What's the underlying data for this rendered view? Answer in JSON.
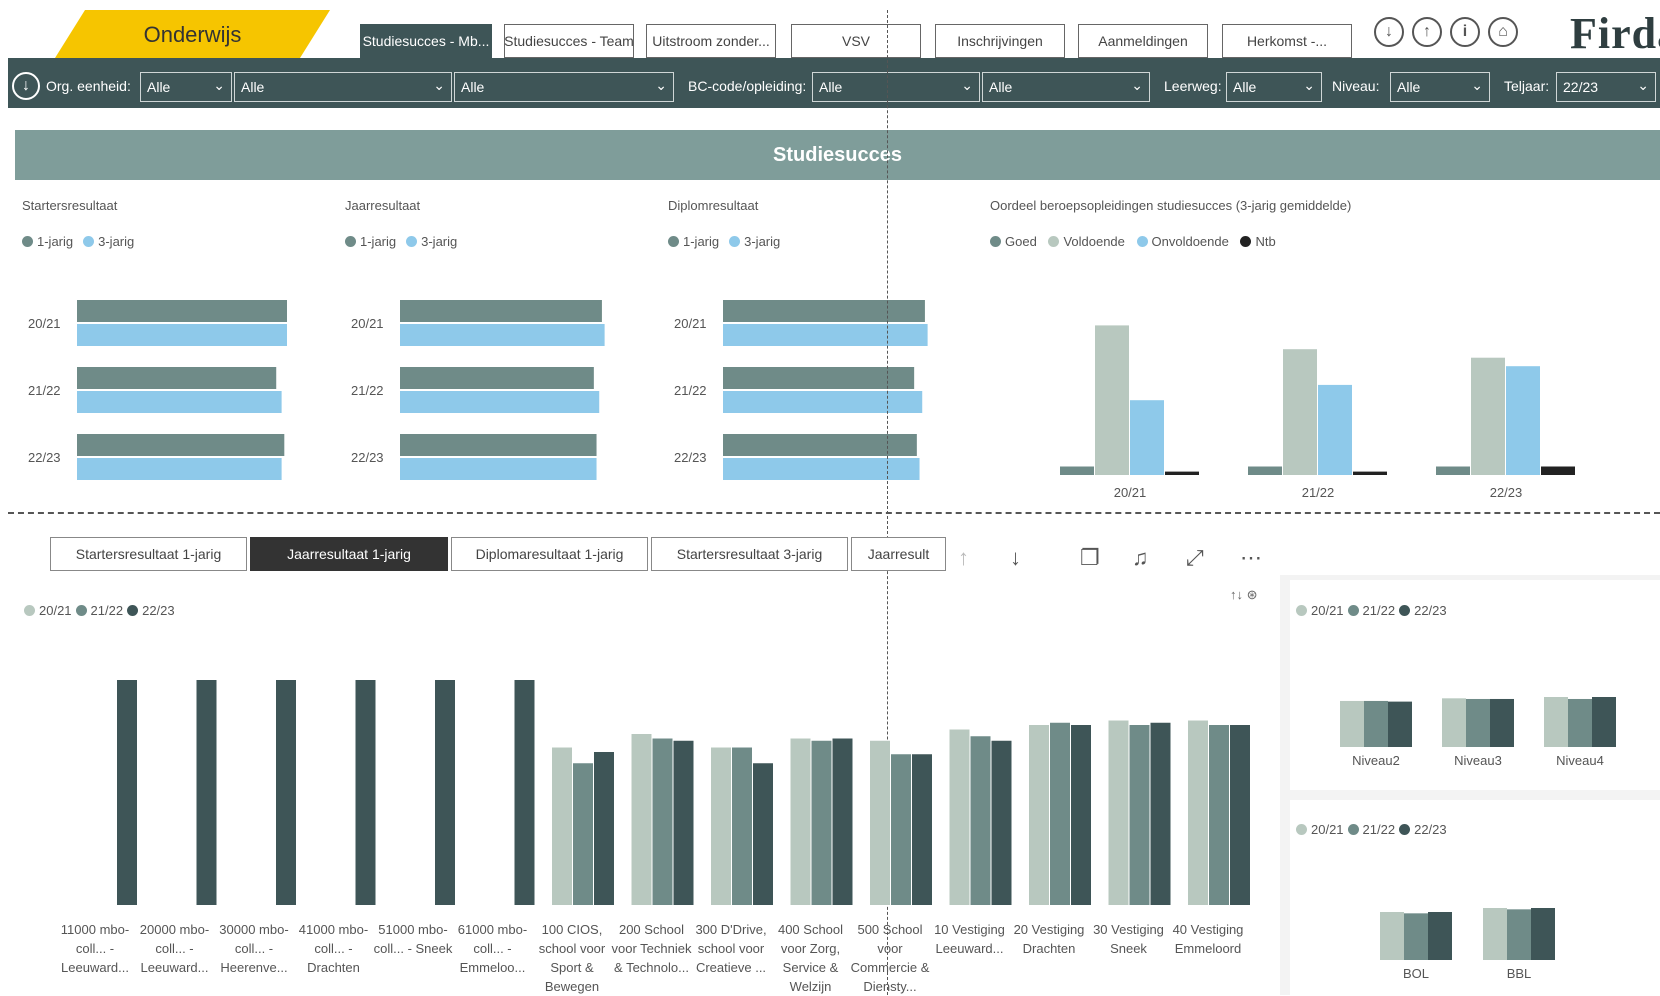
{
  "header": {
    "brand_tab": "Onderwijs",
    "tabs": [
      {
        "label": "Studiesucces - Mb...",
        "active": true
      },
      {
        "label": "Studiesucces - Team",
        "active": false
      },
      {
        "label": "Uitstroom zonder...",
        "active": false
      },
      {
        "label": "VSV",
        "active": false
      },
      {
        "label": "Inschrijvingen",
        "active": false
      },
      {
        "label": "Aanmeldingen",
        "active": false
      },
      {
        "label": "Herkomst -...",
        "active": false
      }
    ],
    "icons": [
      "download-circle-icon",
      "upload-circle-icon",
      "info-circle-icon",
      "home-circle-icon"
    ],
    "logo": "Firda"
  },
  "filters": {
    "org_label": "Org. eenheid:",
    "org_values": [
      "Alle",
      "Alle",
      "Alle"
    ],
    "bc_label": "BC-code/opleiding:",
    "bc_values": [
      "Alle",
      "Alle"
    ],
    "leerweg_label": "Leerweg:",
    "leerweg_value": "Alle",
    "niveau_label": "Niveau:",
    "niveau_value": "Alle",
    "teljaar_label": "Teljaar:",
    "teljaar_value": "22/23"
  },
  "banner": "Studiesucces",
  "colors": {
    "dark_teal": "#3e5557",
    "mid_teal": "#6f8b88",
    "light_sage": "#b8c8bf",
    "sky": "#8ec9ea",
    "black": "#222222",
    "gold": "#f6c500"
  },
  "top_charts": [
    {
      "title": "Startersresultaat",
      "legend": [
        "1-jarig",
        "3-jarig"
      ],
      "years": [
        "20/21",
        "21/22",
        "22/23"
      ],
      "series": [
        {
          "name": "1-jarig",
          "values": [
            0.78,
            0.74,
            0.77
          ]
        },
        {
          "name": "3-jarig",
          "values": [
            0.78,
            0.76,
            0.76
          ]
        }
      ]
    },
    {
      "title": "Jaarresultaat",
      "legend": [
        "1-jarig",
        "3-jarig"
      ],
      "years": [
        "20/21",
        "21/22",
        "22/23"
      ],
      "series": [
        {
          "name": "1-jarig",
          "values": [
            0.75,
            0.72,
            0.73
          ]
        },
        {
          "name": "3-jarig",
          "values": [
            0.76,
            0.74,
            0.73
          ]
        }
      ]
    },
    {
      "title": "Diplomresultaat",
      "legend": [
        "1-jarig",
        "3-jarig"
      ],
      "years": [
        "20/21",
        "21/22",
        "22/23"
      ],
      "series": [
        {
          "name": "1-jarig",
          "values": [
            0.75,
            0.71,
            0.72
          ]
        },
        {
          "name": "3-jarig",
          "values": [
            0.76,
            0.74,
            0.73
          ]
        }
      ]
    }
  ],
  "chart_data": [
    {
      "type": "bar",
      "title": "Oordeel beroepsopleidingen studiesucces (3-jarig gemiddelde)",
      "categories": [
        "20/21",
        "21/22",
        "22/23"
      ],
      "series": [
        {
          "name": "Goed",
          "values": [
            0.5,
            0.5,
            0.5
          ]
        },
        {
          "name": "Voldoende",
          "values": [
            8.8,
            7.4,
            6.9
          ]
        },
        {
          "name": "Onvoldoende",
          "values": [
            4.4,
            5.3,
            6.4
          ]
        },
        {
          "name": "Ntb",
          "values": [
            0.2,
            0.2,
            0.5
          ]
        }
      ],
      "ylim": [
        0,
        10
      ],
      "legend": "top-left"
    },
    {
      "type": "bar",
      "categories": [
        "11000 mbo-coll... - Leeuward...",
        "20000 mbo-coll... - Leeuward...",
        "30000 mbo-coll... - Heerenve...",
        "41000 mbo-coll... - Drachten",
        "51000 mbo-coll... - Sneek",
        "61000 mbo-coll... - Emmeloo...",
        "100 CIOS, school voor Sport & Bewegen",
        "200 School voor Techniek & Technolo...",
        "300 D'Drive, school voor Creatieve ...",
        "400 School voor Zorg, Service & Welzijn",
        "500 School voor Commercie & Diensty...",
        "10 Vestiging Leeuward...",
        "20 Vestiging Drachten",
        "30 Vestiging Sneek",
        "40 Vestiging Emmeloord"
      ],
      "series": [
        {
          "name": "20/21",
          "values": [
            0,
            0,
            0,
            0,
            0,
            0,
            70,
            76,
            70,
            74,
            73,
            78,
            80,
            82,
            82
          ]
        },
        {
          "name": "21/22",
          "values": [
            0,
            0,
            0,
            0,
            0,
            0,
            63,
            74,
            70,
            73,
            67,
            75,
            81,
            80,
            80
          ]
        },
        {
          "name": "22/23",
          "values": [
            100,
            100,
            100,
            100,
            100,
            100,
            68,
            73,
            63,
            74,
            67,
            73,
            80,
            81,
            80
          ]
        }
      ],
      "ylim": [
        0,
        110
      ],
      "legend": "top-left"
    },
    {
      "type": "bar",
      "categories": [
        "Niveau2",
        "Niveau3",
        "Niveau4"
      ],
      "series": [
        {
          "name": "20/21",
          "values": [
            70,
            74,
            76
          ]
        },
        {
          "name": "21/22",
          "values": [
            70,
            73,
            73
          ]
        },
        {
          "name": "22/23",
          "values": [
            69,
            73,
            76
          ]
        }
      ],
      "ylim": [
        0,
        100
      ],
      "legend": "top-left"
    },
    {
      "type": "bar",
      "categories": [
        "BOL",
        "BBL"
      ],
      "series": [
        {
          "name": "20/21",
          "values": [
            72,
            78
          ]
        },
        {
          "name": "21/22",
          "values": [
            70,
            76
          ]
        },
        {
          "name": "22/23",
          "values": [
            72,
            78
          ]
        }
      ],
      "ylim": [
        0,
        100
      ],
      "legend": "top-left"
    }
  ],
  "bottom_tabs": [
    {
      "label": "Startersresultaat 1-jarig",
      "active": false
    },
    {
      "label": "Jaarresultaat 1-jarig",
      "active": true
    },
    {
      "label": "Diplomaresultaat 1-jarig",
      "active": false
    },
    {
      "label": "Startersresultaat 3-jarig",
      "active": false
    },
    {
      "label": "Jaarresult",
      "active": false
    }
  ],
  "legend_years": [
    "20/21",
    "21/22",
    "22/23"
  ],
  "top_legend_oordeel": [
    "Goed",
    "Voldoende",
    "Onvoldoende",
    "Ntb"
  ]
}
